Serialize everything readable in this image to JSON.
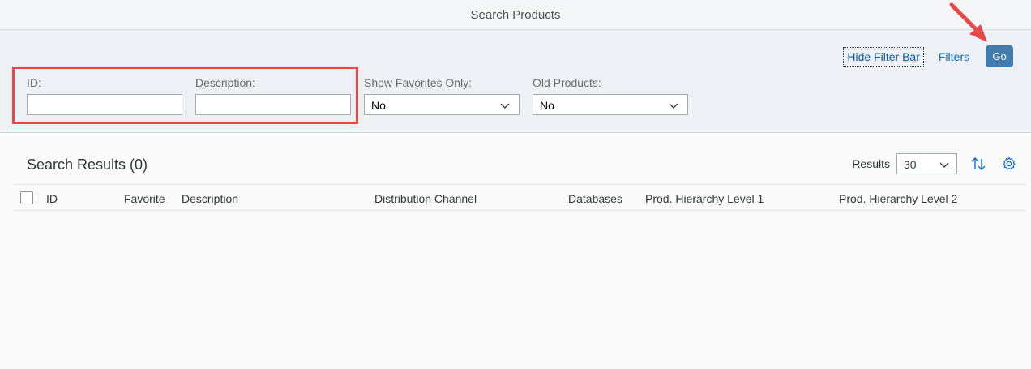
{
  "window": {
    "title": "Search Products"
  },
  "filter_bar": {
    "hide_filter_bar_label": "Hide Filter Bar",
    "filters_label": "Filters",
    "go_label": "Go",
    "fields": {
      "id": {
        "label": "ID:",
        "value": ""
      },
      "description": {
        "label": "Description:",
        "value": ""
      },
      "show_favorites": {
        "label": "Show Favorites Only:",
        "value": "No"
      },
      "old_products": {
        "label": "Old Products:",
        "value": "No"
      }
    }
  },
  "results": {
    "title": "Search Results (0)",
    "results_label": "Results",
    "results_count": "30",
    "columns": [
      "ID",
      "Favorite",
      "Description",
      "Distribution Channel",
      "Databases",
      "Prod. Hierarchy Level 1",
      "Prod. Hierarchy Level 2"
    ]
  },
  "icons": {
    "sort": "sort-icon",
    "settings": "gear-icon",
    "dropdown": "chevron-down-icon"
  },
  "colors": {
    "accent": "#0a6ed1",
    "go_button": "#427cac",
    "annotation_red": "#e8474a"
  }
}
